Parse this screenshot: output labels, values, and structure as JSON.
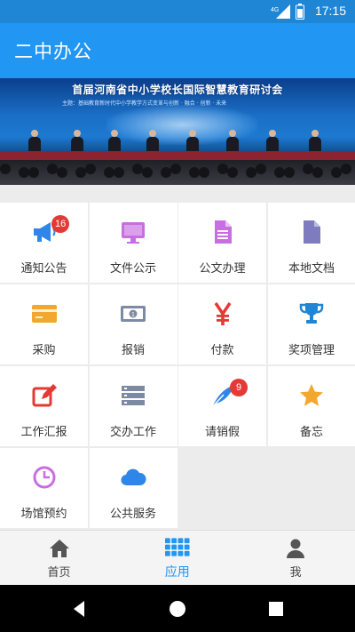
{
  "status_bar": {
    "time": "17:15",
    "network": "4G"
  },
  "app_bar": {
    "title": "二中办公"
  },
  "banner": {
    "headline": "首届河南省中小学校长国际智慧教育研讨会",
    "subline": "主题：基础教育新时代中小学教学方式变革与创新 · 融合 · 创新 · 未来"
  },
  "apps": [
    {
      "label": "通知公告",
      "icon": "megaphone-icon",
      "color": "#2f86e8",
      "badge": "16"
    },
    {
      "label": "文件公示",
      "icon": "monitor-icon",
      "color": "#c86ee0",
      "badge": ""
    },
    {
      "label": "公文办理",
      "icon": "document-icon",
      "color": "#c86ee0",
      "badge": ""
    },
    {
      "label": "本地文档",
      "icon": "file-icon",
      "color": "#7e7bbf",
      "badge": ""
    },
    {
      "label": "采购",
      "icon": "card-icon",
      "color": "#f2a82f",
      "badge": ""
    },
    {
      "label": "报销",
      "icon": "money-icon",
      "color": "#7d8aa3",
      "badge": ""
    },
    {
      "label": "付款",
      "icon": "yen-icon",
      "color": "#e53935",
      "badge": ""
    },
    {
      "label": "奖项管理",
      "icon": "trophy-icon",
      "color": "#1f86d6",
      "badge": ""
    },
    {
      "label": "工作汇报",
      "icon": "edit-icon",
      "color": "#e53935",
      "badge": ""
    },
    {
      "label": "交办工作",
      "icon": "server-icon",
      "color": "#7d8aa3",
      "badge": ""
    },
    {
      "label": "请销假",
      "icon": "quill-icon",
      "color": "#2f86e8",
      "badge": "9"
    },
    {
      "label": "备忘",
      "icon": "star-icon",
      "color": "#f2a82f",
      "badge": ""
    },
    {
      "label": "场馆预约",
      "icon": "clock-icon",
      "color": "#c86ee0",
      "badge": ""
    },
    {
      "label": "公共服务",
      "icon": "cloud-icon",
      "color": "#2f86e8",
      "badge": ""
    }
  ],
  "bottom_nav": [
    {
      "label": "首页",
      "icon": "home-icon",
      "active": false
    },
    {
      "label": "应用",
      "icon": "apps-grid-icon",
      "active": true
    },
    {
      "label": "我",
      "icon": "user-icon",
      "active": false
    }
  ],
  "colors": {
    "primary": "#2196f3",
    "status_bar": "#1f86d6",
    "badge": "#e53935",
    "active_tab": "#2196f3"
  }
}
